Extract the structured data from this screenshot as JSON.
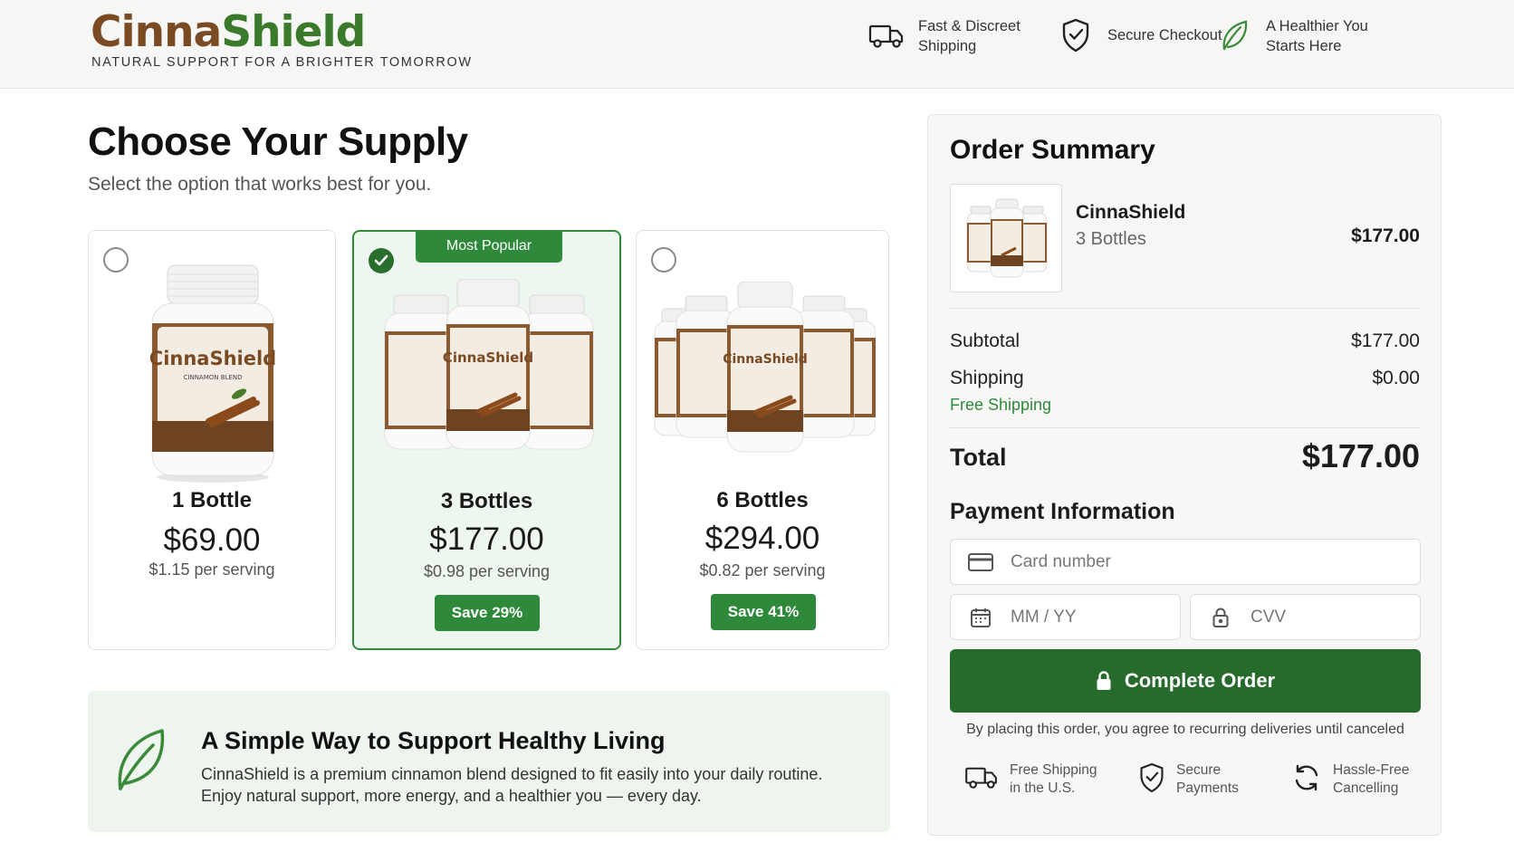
{
  "brand": {
    "name_part1": "Cinna",
    "name_part2": "Shield",
    "tagline": "NATURAL SUPPORT FOR A BRIGHTER TOMORROW"
  },
  "header_features": [
    {
      "icon": "truck-icon",
      "text": "Fast & Discreet Shipping"
    },
    {
      "icon": "shield-check-icon",
      "text": "Secure Checkout"
    },
    {
      "icon": "leaf-icon",
      "text": "A Healthier You Starts Here"
    }
  ],
  "main": {
    "title": "Choose Your Supply",
    "subtitle": "Select the option that works best for you."
  },
  "packages": [
    {
      "quantity": "1 Bottle",
      "price": "$69.00",
      "per_serving": "$1.15 per serving",
      "savings": "",
      "selected": false,
      "badge": ""
    },
    {
      "quantity": "3 Bottles",
      "price": "$177.00",
      "per_serving": "$0.98 per serving",
      "savings": "Save 29%",
      "selected": true,
      "badge": "Most Popular"
    },
    {
      "quantity": "6 Bottles",
      "price": "$294.00",
      "per_serving": "$0.82 per serving",
      "savings": "Save 41%",
      "selected": false,
      "badge": ""
    }
  ],
  "bottle_label": {
    "brand": "CinnaShield",
    "sub": "CINNAMON BLEND"
  },
  "benefit": {
    "title": "A Simple Way to Support Healthy Living",
    "line1": "CinnaShield is a premium cinnamon blend designed to fit easily into your daily routine.",
    "line2": "Enjoy natural support, more energy, and a healthier you — every day."
  },
  "summary": {
    "title": "Order Summary",
    "product_name": "CinnaShield",
    "product_qty": "3 Bottles",
    "product_price": "$177.00",
    "subtotal_label": "Subtotal",
    "subtotal_value": "$177.00",
    "shipping_label": "Shipping",
    "shipping_value": "$0.00",
    "shipping_note": "Free Shipping",
    "total_label": "Total",
    "total_value": "$177.00"
  },
  "payment": {
    "title": "Payment Information",
    "card_placeholder": "Card number",
    "expiry_placeholder": "MM / YY",
    "cvv_placeholder": "CVV",
    "submit_label": "Complete Order",
    "agreement": "By placing this order, you agree to recurring deliveries until canceled"
  },
  "footer_features": [
    {
      "icon": "truck-icon",
      "text": "Free Shipping in the U.S."
    },
    {
      "icon": "shield-check-icon",
      "text": "Secure Payments"
    },
    {
      "icon": "refresh-icon",
      "text": "Hassle-Free Cancelling"
    }
  ],
  "colors": {
    "brand_brown": "#7a4a23",
    "brand_green": "#3a7a2a",
    "accent_green": "#2e8a3a",
    "cta_green": "#266b2c"
  }
}
